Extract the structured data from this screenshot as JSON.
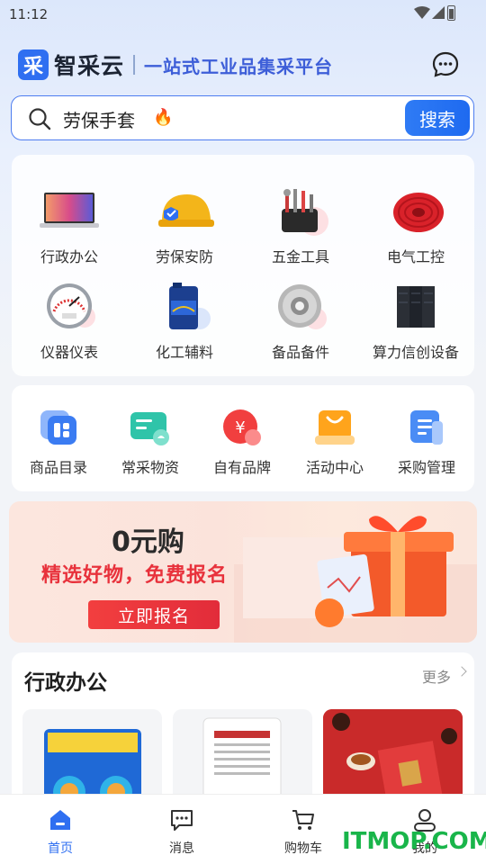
{
  "status_bar": {
    "time": "11:12"
  },
  "header": {
    "logo_char": "采",
    "app_name": "智采云",
    "slogan": "一站式工业品集采平台",
    "message_icon": "chat-bubble-icon"
  },
  "search": {
    "query": "劳保手套",
    "hot_icon": "🔥",
    "button_label": "搜索"
  },
  "categories": [
    {
      "label": "行政办公",
      "icon": "laptop-icon"
    },
    {
      "label": "劳保安防",
      "icon": "hard-hat-icon"
    },
    {
      "label": "五金工具",
      "icon": "toolkit-icon"
    },
    {
      "label": "电气工控",
      "icon": "cable-reel-icon"
    },
    {
      "label": "仪器仪表",
      "icon": "gauge-icon"
    },
    {
      "label": "化工辅料",
      "icon": "oil-can-icon"
    },
    {
      "label": "备品备件",
      "icon": "disc-icon"
    },
    {
      "label": "算力信创设备",
      "icon": "server-rack-icon"
    }
  ],
  "tools": [
    {
      "label": "商品目录",
      "icon": "catalog-icon"
    },
    {
      "label": "常采物资",
      "icon": "frequent-items-icon"
    },
    {
      "label": "自有品牌",
      "icon": "brand-icon"
    },
    {
      "label": "活动中心",
      "icon": "shopping-bag-icon"
    },
    {
      "label": "采购管理",
      "icon": "document-icon"
    }
  ],
  "banner": {
    "title": "0元购",
    "subtitle": "精选好物，免费报名",
    "button_label": "立即报名"
  },
  "section": {
    "title": "行政办公",
    "more_label": "更多"
  },
  "tabbar": [
    {
      "label": "首页",
      "icon": "home-icon",
      "active": true
    },
    {
      "label": "消息",
      "icon": "message-icon",
      "active": false
    },
    {
      "label": "购物车",
      "icon": "cart-icon",
      "active": false
    },
    {
      "label": "我的",
      "icon": "user-icon",
      "active": false
    }
  ],
  "watermark": "ITMOP.COM",
  "colors": {
    "accent": "#2f6ff1",
    "promo_red": "#e8323c"
  }
}
